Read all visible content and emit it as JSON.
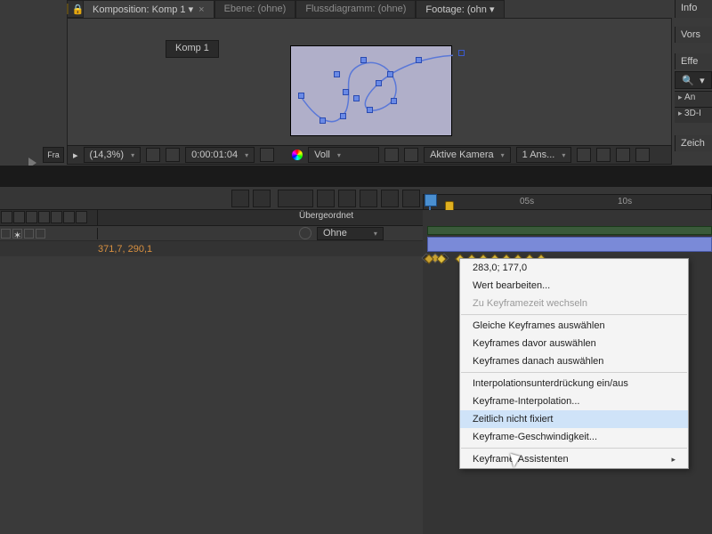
{
  "viewerTabs": {
    "comp": "Komposition: Komp 1",
    "layer": "Ebene: (ohne)",
    "flow": "Flussdiagramm: (ohne)",
    "footage": "Footage: (ohn"
  },
  "breadcrumb": "Komp 1",
  "viewerFooter": {
    "zoom": "(14,3%)",
    "time": "0:00:01:04",
    "channel": "Voll",
    "camera": "Aktive Kamera",
    "views": "1 Ans..."
  },
  "sidePanels": {
    "info": "Info",
    "vors": "Vors",
    "eff": "Effe",
    "row1": "An",
    "row2": "3D-I",
    "zeich": "Zeich"
  },
  "smallTab": "Fra",
  "timeline": {
    "parentHdr": "Übergeordnet",
    "parentVal": "Ohne",
    "posVal": "371,7, 290,1",
    "ticks": {
      "t5": "05s",
      "t10": "10s"
    }
  },
  "ctx": {
    "coord": "283,0; 177,0",
    "edit": "Wert bearbeiten...",
    "goto": "Zu Keyframezeit wechseln",
    "same": "Gleiche Keyframes auswählen",
    "before": "Keyframes davor auswählen",
    "after": "Keyframes danach auswählen",
    "hold": "Interpolationsunterdrückung ein/aus",
    "interp": "Keyframe-Interpolation...",
    "rove": "Zeitlich nicht fixiert",
    "velo": "Keyframe-Geschwindigkeit...",
    "assist": "Keyframe-Assistenten"
  }
}
